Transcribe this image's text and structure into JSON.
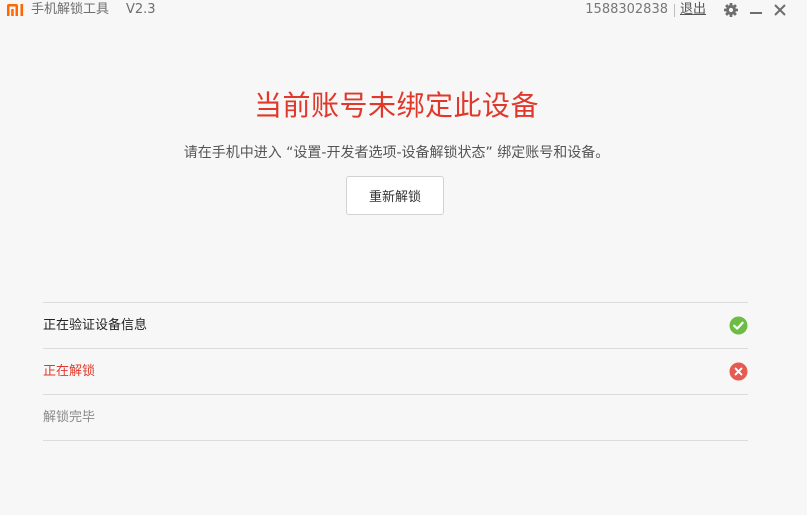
{
  "titlebar": {
    "app_name": "手机解锁工具",
    "version": "V2.3",
    "account": "1588302838",
    "logout_label": "退出",
    "icons": [
      "mi-logo-icon",
      "gear-icon",
      "minimize-icon",
      "close-icon"
    ]
  },
  "main": {
    "headline": "当前账号未绑定此设备",
    "instruction": "请在手机中进入 “设置-开发者选项-设备解锁状态” 绑定账号和设备。",
    "retry_label": "重新解锁"
  },
  "steps": [
    {
      "label": "正在验证设备信息",
      "status": "success",
      "color": "#222222"
    },
    {
      "label": "正在解锁",
      "status": "error",
      "color": "#e0392b"
    },
    {
      "label": "解锁完毕",
      "status": "pending",
      "color": "#8a8a8a"
    }
  ],
  "colors": {
    "accent": "#e0392b",
    "brand": "#ff6700",
    "success": "#6dbd44",
    "error": "#e85a4f"
  }
}
